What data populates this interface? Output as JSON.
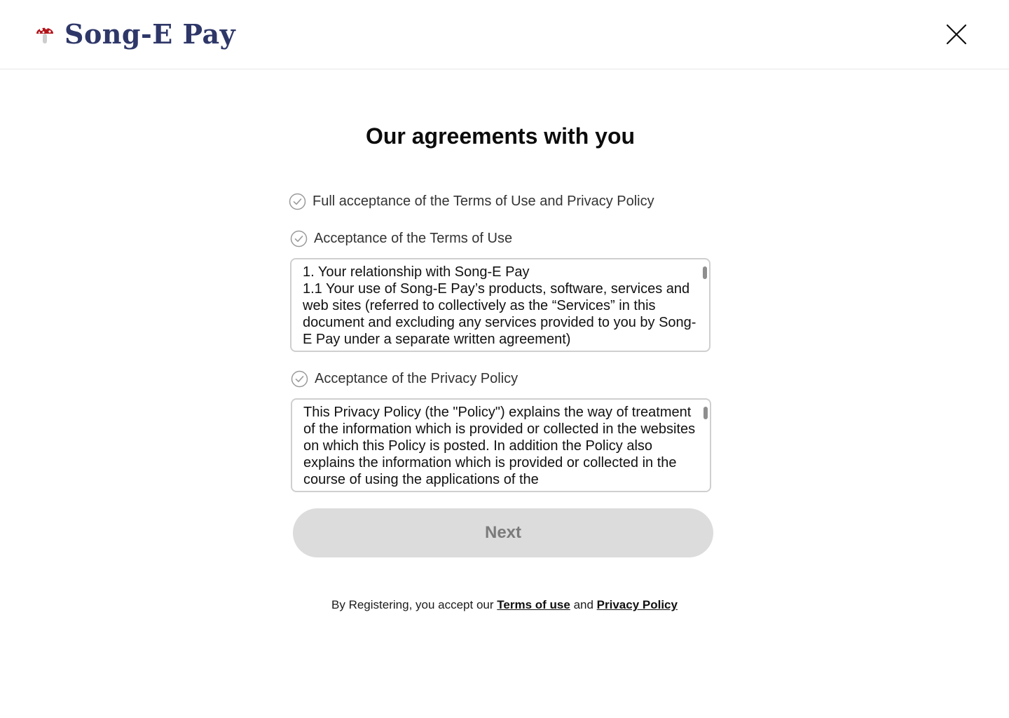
{
  "header": {
    "brand": "Song-E Pay",
    "logo_icon": "mushroom-icon",
    "close_icon": "close-icon"
  },
  "main": {
    "title": "Our agreements with you",
    "full_acceptance": {
      "label": "Full acceptance of the Terms of Use and Privacy Policy",
      "icon": "check-circle-icon"
    },
    "terms": {
      "label": "Acceptance of the Terms of Use",
      "icon": "check-circle-icon",
      "text": "1. Your relationship with Song-E Pay\n1.1 Your use of Song-E Pay’s products, software, services and web sites (referred to collectively as the “Services” in this document and excluding any services provided to you by Song-E Pay under a separate written agreement)"
    },
    "privacy": {
      "label": "Acceptance of the Privacy Policy",
      "icon": "check-circle-icon",
      "text": "This Privacy Policy (the \"Policy\") explains the way of treatment of the information which is provided or collected in the websites on which this Policy is posted. In addition the Policy also explains the information which is provided or collected in the course of using the applications of the"
    },
    "next_label": "Next"
  },
  "footer": {
    "prefix": "By Registering, you accept our",
    "terms_link": "Terms of use",
    "conjunction": "and",
    "privacy_link": "Privacy Policy"
  },
  "colors": {
    "brand": "#2e3768",
    "button_bg": "#dcdcdc",
    "button_text": "#7b7b7b",
    "check_gray": "#9a9a9a",
    "box_border": "#cfcfcf"
  }
}
